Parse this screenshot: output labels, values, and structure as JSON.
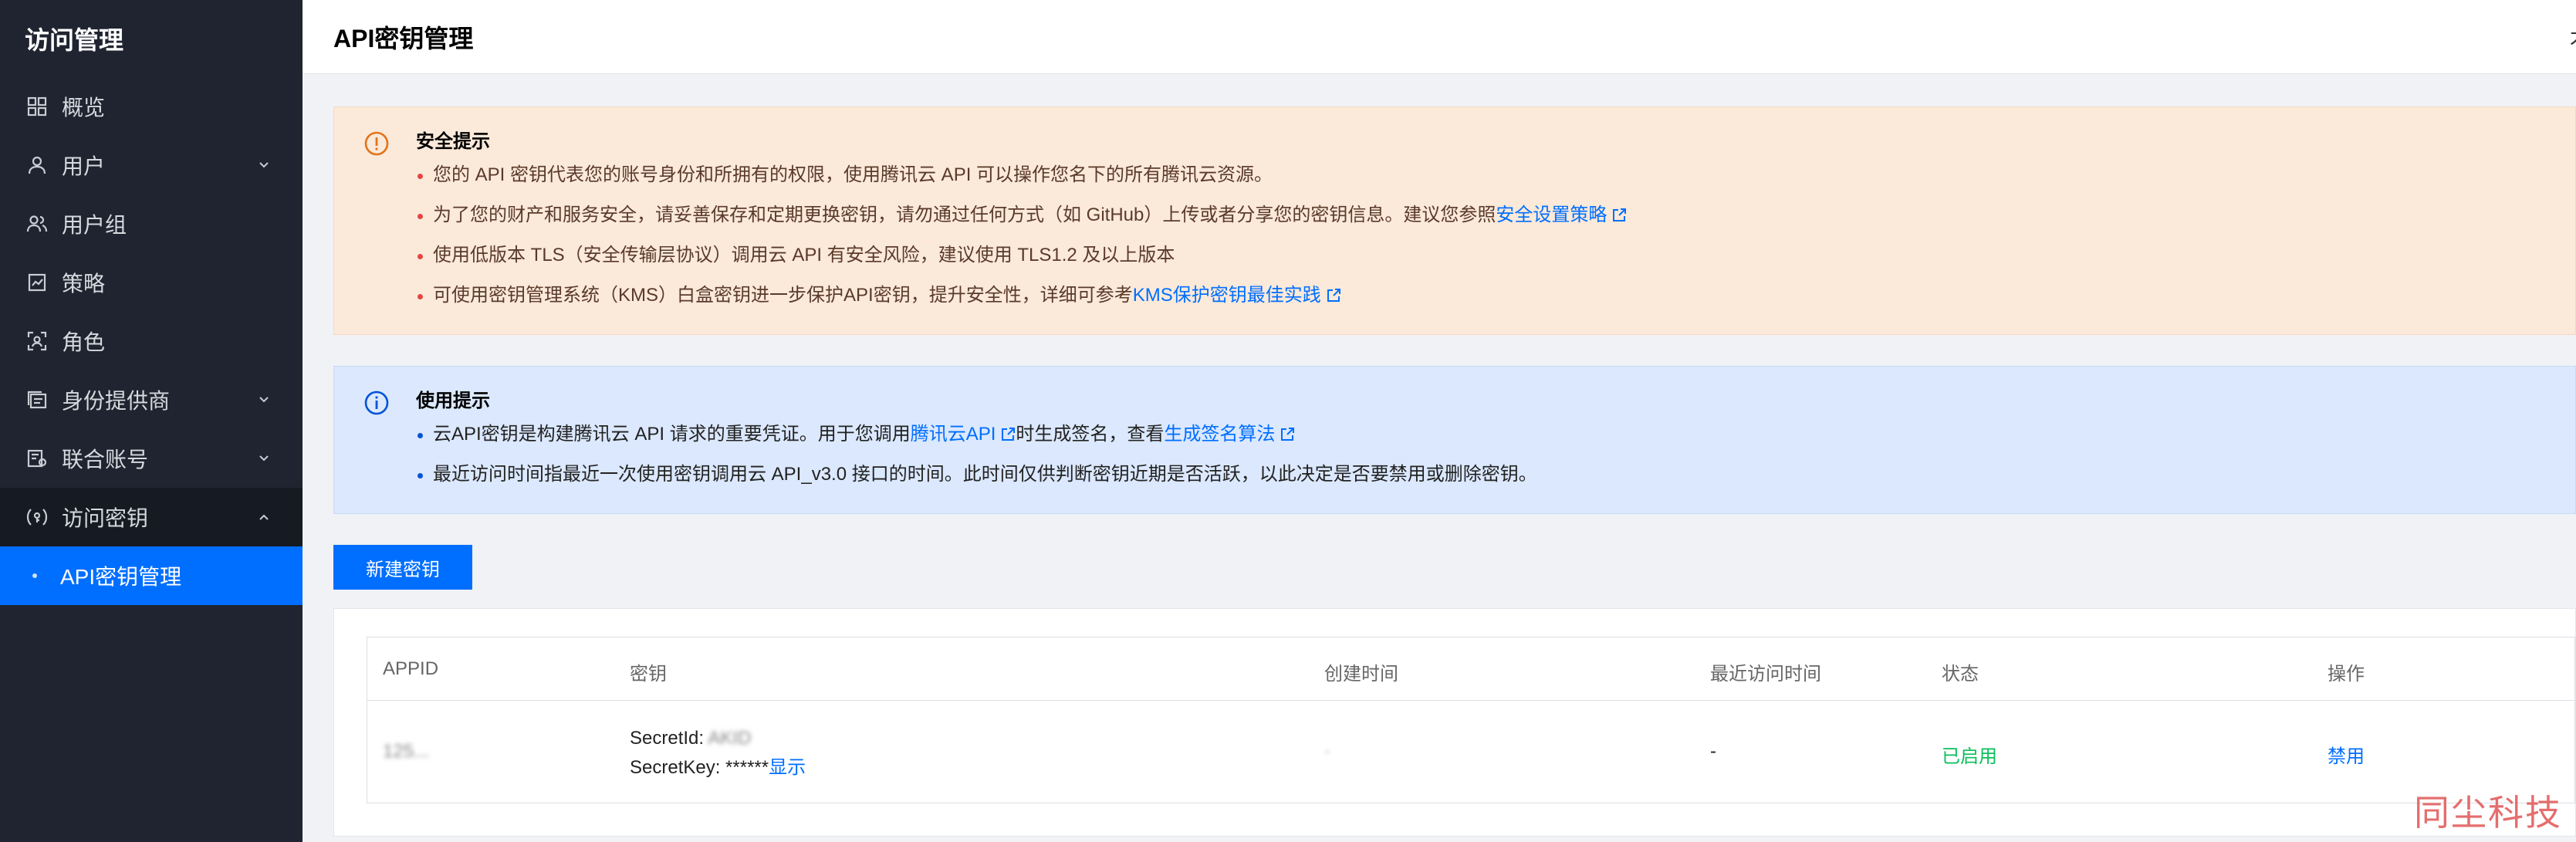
{
  "sidebar": {
    "title": "访问管理",
    "items": [
      {
        "label": "概览",
        "icon": "dashboard-icon"
      },
      {
        "label": "用户",
        "icon": "user-icon",
        "has_chevron": true
      },
      {
        "label": "用户组",
        "icon": "user-group-icon"
      },
      {
        "label": "策略",
        "icon": "policy-icon"
      },
      {
        "label": "角色",
        "icon": "role-icon"
      },
      {
        "label": "身份提供商",
        "icon": "identity-provider-icon",
        "has_chevron": true
      },
      {
        "label": "联合账号",
        "icon": "federated-account-icon",
        "has_chevron": true
      },
      {
        "label": "访问密钥",
        "icon": "access-key-icon",
        "expanded": true
      }
    ],
    "sub_item": "API密钥管理"
  },
  "header": {
    "title": "API密钥管理",
    "edge_text": "才"
  },
  "security_notice": {
    "title": "安全提示",
    "items": [
      {
        "text": "您的 API 密钥代表您的账号身份和所拥有的权限，使用腾讯云 API 可以操作您名下的所有腾讯云资源。"
      },
      {
        "text": "为了您的财产和服务安全，请妥善保存和定期更换密钥，请勿通过任何方式（如 GitHub）上传或者分享您的密钥信息。建议您参照",
        "link": "安全设置策略"
      },
      {
        "text": "使用低版本 TLS（安全传输层协议）调用云 API 有安全风险，建议使用 TLS1.2 及以上版本"
      },
      {
        "text": "可使用密钥管理系统（KMS）白盒密钥进一步保护API密钥，提升安全性，详细可参考",
        "link": "KMS保护密钥最佳实践"
      }
    ]
  },
  "usage_notice": {
    "title": "使用提示",
    "item1": {
      "pre": "云API密钥是构建腾讯云 API 请求的重要凭证。用于您调用",
      "link1": "腾讯云API",
      "mid": "时生成签名，查看",
      "link2": "生成签名算法"
    },
    "item2": "最近访问时间指最近一次使用密钥调用云 API_v3.0 接口的时间。此时间仅供判断密钥近期是否活跃，以此决定是否要禁用或删除密钥。"
  },
  "new_key_button": "新建密钥",
  "table": {
    "headers": [
      "APPID",
      "密钥",
      "创建时间",
      "最近访问时间",
      "状态",
      "操作"
    ],
    "row": {
      "appid": "125...",
      "secret_id_label": "SecretId:",
      "secret_id_value": "AKID",
      "secret_key_label": "SecretKey: ******",
      "show_link": "显示",
      "created": "·",
      "last_access": "-",
      "status": "已启用",
      "action": "禁用"
    }
  },
  "watermark": "同尘科技",
  "colors": {
    "primary": "#006eff",
    "sidebar_bg": "#1f2430",
    "warn_bg": "#fbe9d9",
    "info_bg": "#dbe8fd",
    "status_green": "#0abf5b"
  }
}
